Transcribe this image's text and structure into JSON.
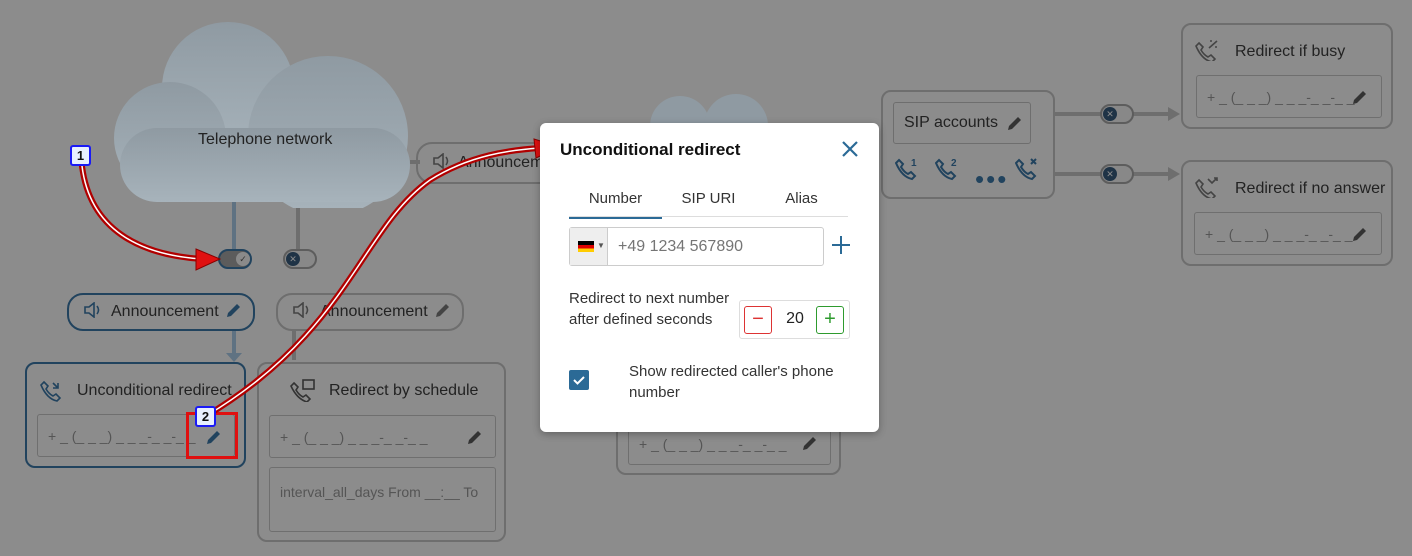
{
  "cloud": {
    "label": "Telephone network"
  },
  "announcements": {
    "left": "Announcement",
    "middle": "Announcement",
    "top_partial": "Announcement"
  },
  "unconditional_card": {
    "title": "Unconditional redirect",
    "field_value": "+ _ (_ _ _) _ _ _-_ _-_ _"
  },
  "schedule_card": {
    "title": "Redirect by schedule",
    "field_value": "+ _ (_ _ _) _ _ _-_ _-_ _",
    "schedule_text": "interval_all_days From __:__ To"
  },
  "hidden_card": {
    "field_value": "+ _ (_ _ _) _ _ _-_ _-_ _"
  },
  "sip": {
    "button_label": "SIP accounts"
  },
  "busy_card": {
    "title": "Redirect if busy",
    "field_value": "+ _ (_ _ _) _ _ _-_ _-_ _"
  },
  "noanswer_card": {
    "title": "Redirect if no answer",
    "field_value": "+ _ (_ _ _) _ _ _-_ _-_ _"
  },
  "modal": {
    "title": "Unconditional redirect",
    "tabs": [
      "Number",
      "SIP URI",
      "Alias"
    ],
    "active_tab": "Number",
    "phone_placeholder": "+49 1234 567890",
    "redirect_label": "Redirect to next number after defined seconds",
    "seconds_value": "20",
    "show_caller_label": "Show redirected caller's phone number",
    "show_caller_checked": true
  },
  "annotations": {
    "badge1": "1",
    "badge2": "2"
  },
  "colors": {
    "accent": "#2b6a96",
    "overlay": "#8c8c8c",
    "highlight_red": "#e01010",
    "badge_border": "#1a1af5"
  }
}
